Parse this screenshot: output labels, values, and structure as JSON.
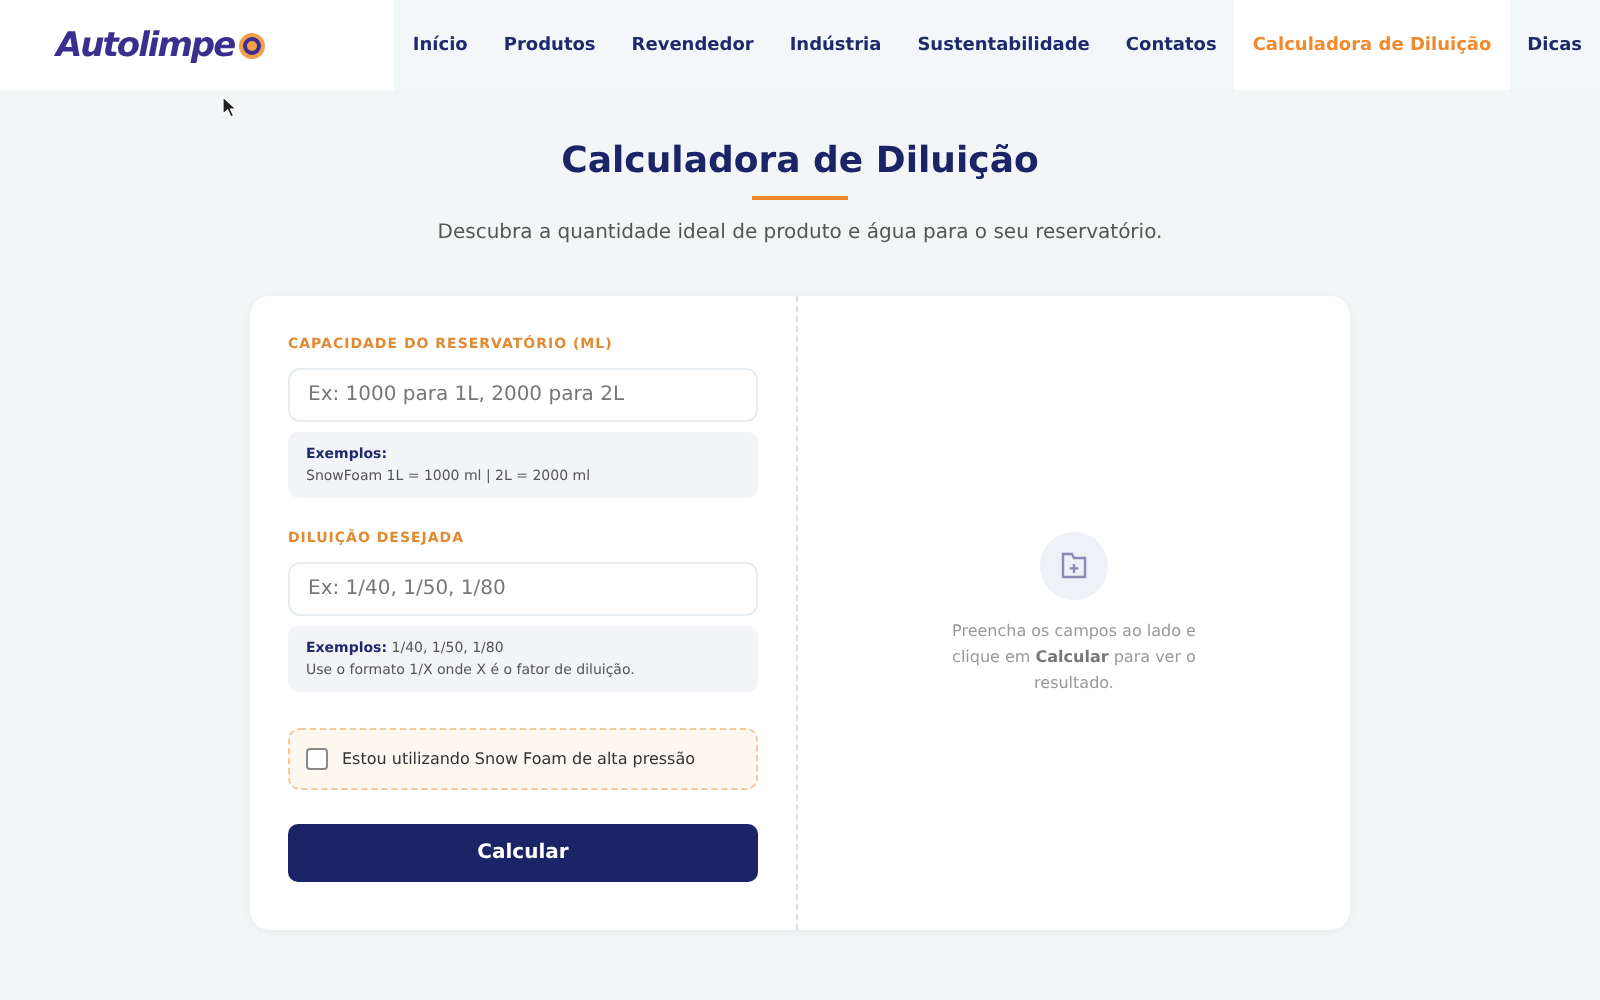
{
  "logo": {
    "text": "Autolimpe"
  },
  "nav": [
    {
      "label": "Início",
      "selected": false
    },
    {
      "label": "Produtos",
      "selected": false
    },
    {
      "label": "Revendedor",
      "selected": false
    },
    {
      "label": "Indústria",
      "selected": false
    },
    {
      "label": "Sustentabilidade",
      "selected": false
    },
    {
      "label": "Contatos",
      "selected": false
    },
    {
      "label": "Calculadora de Diluição",
      "selected": true
    },
    {
      "label": "Dicas",
      "selected": false
    }
  ],
  "page": {
    "title": "Calculadora de Diluição",
    "subtitle": "Descubra a quantidade ideal de produto e água para o seu reservatório."
  },
  "form": {
    "fields": [
      {
        "label": "CAPACIDADE DO RESERVATÓRIO (ML)",
        "placeholder": "Ex: 1000 para 1L, 2000 para 2L",
        "note_lines": [
          "**Exemplos:**",
          "SnowFoam 1L = 1000 ml  |  2L = 2000 ml"
        ]
      },
      {
        "label": "DILUIÇÃO DESEJADA",
        "placeholder": "Ex: 1/40, 1/50, 1/80",
        "note_lines": [
          "**Exemplos:** 1/40, 1/50, 1/80",
          "Use o formato 1/X onde X é o fator de diluição."
        ]
      }
    ],
    "snow_foam": {
      "label": "Estou utilizando Snow Foam de alta pressão",
      "checked": false
    },
    "submit": "Calcular"
  },
  "result": {
    "message": "Preencha os campos ao lado e clique em **Calcular** para ver o resultado."
  }
}
